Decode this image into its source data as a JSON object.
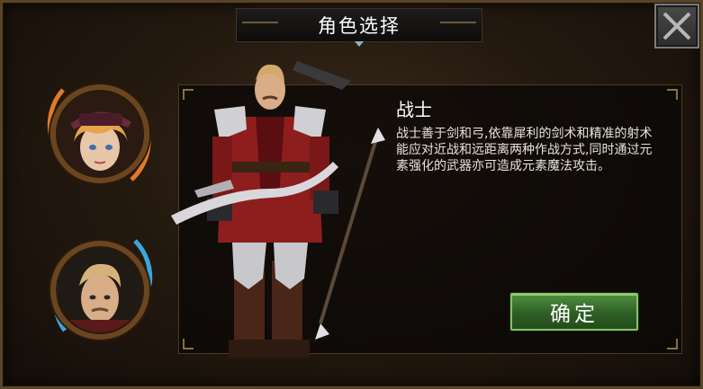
{
  "header": {
    "title": "角色选择"
  },
  "selected_class": {
    "name": "战士",
    "description": "战士善于剑和弓,依靠犀利的剑术和精准的射术能应对近战和远距离两种作战方式,同时通过元素强化的武器亦可造成元素魔法攻击。"
  },
  "actions": {
    "confirm_label": "确定"
  },
  "portraits": [
    {
      "role": "female-hero",
      "ring_color": "#e07a2a"
    },
    {
      "role": "male-hero",
      "ring_color": "#3aa6e0"
    }
  ],
  "colors": {
    "confirm_button": "#2d5e24",
    "panel_border": "#4a3a24",
    "accent_orange": "#e07a2a",
    "accent_blue": "#3aa6e0"
  }
}
